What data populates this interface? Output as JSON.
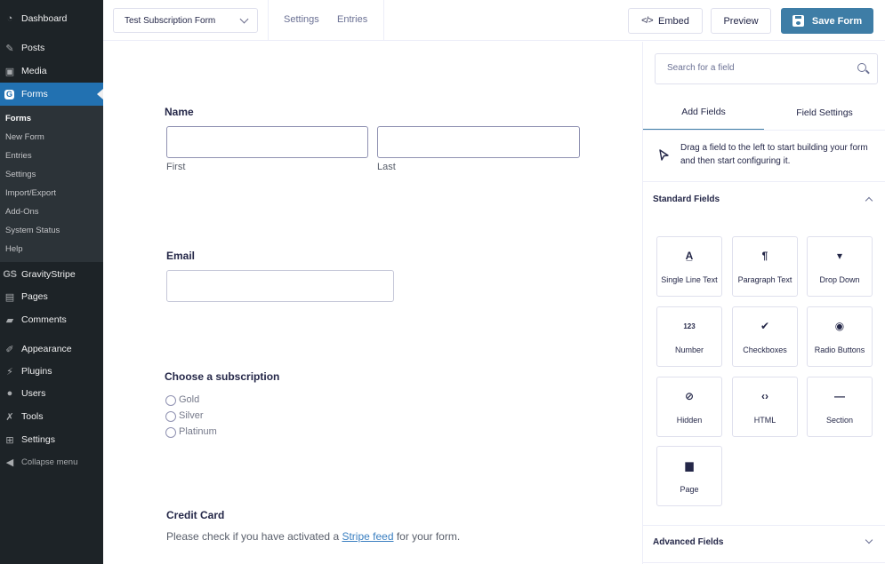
{
  "wp_menu": {
    "items": [
      {
        "key": "dashboard",
        "label": "Dashboard",
        "icon": "dashboard-icon",
        "glyph": "◔"
      },
      {
        "key": "posts",
        "label": "Posts",
        "icon": "pin-icon",
        "glyph": "✎"
      },
      {
        "key": "media",
        "label": "Media",
        "icon": "media-icon",
        "glyph": "▣"
      },
      {
        "key": "forms",
        "label": "Forms",
        "icon": "gravity-forms-icon",
        "glyph": "G",
        "active": true
      },
      {
        "key": "gravitystripe",
        "label": "GravityStripe",
        "icon": "gs-logo-icon",
        "glyph": "GS"
      },
      {
        "key": "pages",
        "label": "Pages",
        "icon": "pages-icon",
        "glyph": "▤"
      },
      {
        "key": "comments",
        "label": "Comments",
        "icon": "comment-icon",
        "glyph": "▰"
      },
      {
        "key": "appearance",
        "label": "Appearance",
        "icon": "paintbrush-icon",
        "glyph": "✐"
      },
      {
        "key": "plugins",
        "label": "Plugins",
        "icon": "plug-icon",
        "glyph": "⚡"
      },
      {
        "key": "users",
        "label": "Users",
        "icon": "user-icon",
        "glyph": "●"
      },
      {
        "key": "tools",
        "label": "Tools",
        "icon": "wrench-icon",
        "glyph": "✗"
      },
      {
        "key": "settings",
        "label": "Settings",
        "icon": "sliders-icon",
        "glyph": "⊞"
      }
    ],
    "forms_submenu": [
      "Forms",
      "New Form",
      "Entries",
      "Settings",
      "Import/Export",
      "Add-Ons",
      "System Status",
      "Help"
    ],
    "collapse_label": "Collapse menu",
    "collapse_glyph": "◀"
  },
  "topbar": {
    "form_selector": "Test Subscription Form",
    "links": [
      "Settings",
      "Entries"
    ],
    "embed_glyph": "</>",
    "embed_label": "Embed",
    "preview_label": "Preview",
    "save_label": "Save Form"
  },
  "form": {
    "name_label": "Name",
    "first_label": "First",
    "last_label": "Last",
    "email_label": "Email",
    "subscription_label": "Choose a subscription",
    "subscription_options": [
      "Gold",
      "Silver",
      "Platinum"
    ],
    "credit_card_label": "Credit Card",
    "credit_card_note_before": "Please check if you have activated a ",
    "credit_card_note_link": "Stripe feed",
    "credit_card_note_after": " for your form."
  },
  "panel": {
    "search_placeholder": "Search for a field",
    "tabs": [
      "Add Fields",
      "Field Settings"
    ],
    "active_tab": "Add Fields",
    "hint": "Drag a field to the left to start building your form and then start configuring it.",
    "standard_title": "Standard Fields",
    "standard_fields": [
      {
        "label": "Single Line Text",
        "icon": "single-line-text-icon",
        "glyph": "A̲"
      },
      {
        "label": "Paragraph Text",
        "icon": "paragraph-icon",
        "glyph": "¶"
      },
      {
        "label": "Drop Down",
        "icon": "dropdown-icon",
        "glyph": "▾"
      },
      {
        "label": "Number",
        "icon": "number-icon",
        "glyph": "123"
      },
      {
        "label": "Checkboxes",
        "icon": "checkbox-icon",
        "glyph": "✔"
      },
      {
        "label": "Radio Buttons",
        "icon": "radio-icon",
        "glyph": "◉"
      },
      {
        "label": "Hidden",
        "icon": "eye-slash-icon",
        "glyph": "⊘"
      },
      {
        "label": "HTML",
        "icon": "code-icon",
        "glyph": "‹›"
      },
      {
        "label": "Section",
        "icon": "section-divider-icon",
        "glyph": "—"
      },
      {
        "label": "Page",
        "icon": "page-icon",
        "glyph": "▆"
      }
    ],
    "advanced_title": "Advanced Fields"
  },
  "colors": {
    "wp_sidebar": "#1d2327",
    "wp_submenu": "#2c3338",
    "wp_active": "#2271b1",
    "primary_button": "#3e7da6",
    "link": "#3a7fc1"
  }
}
